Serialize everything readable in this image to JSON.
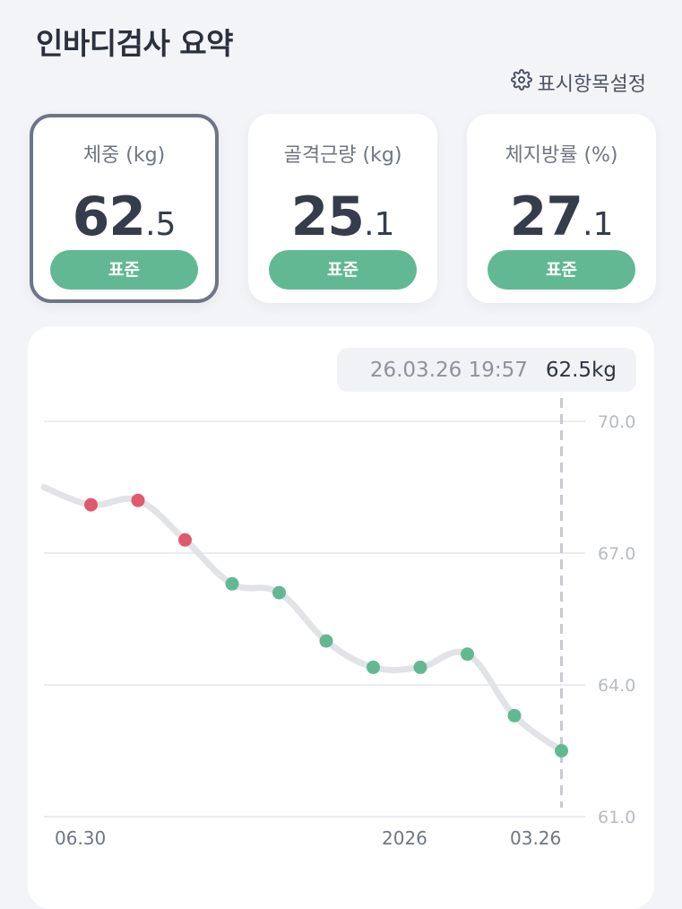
{
  "header": {
    "title": "인바디검사 요약",
    "settings_label": "표시항목설정"
  },
  "cards": [
    {
      "label": "체중 (kg)",
      "value_int": "62",
      "value_dec": ".5",
      "status": "표준",
      "selected": true
    },
    {
      "label": "골격근량 (kg)",
      "value_int": "25",
      "value_dec": ".1",
      "status": "표준",
      "selected": false
    },
    {
      "label": "체지방률 (%)",
      "value_int": "27",
      "value_dec": ".1",
      "status": "표준",
      "selected": false
    }
  ],
  "tooltip": {
    "date": "26.03.26 19:57",
    "value": "62.5kg"
  },
  "colors": {
    "normal": "#62b893",
    "over": "#e05a6e",
    "line": "#e2e3e6",
    "accent": "#62b893"
  },
  "chart_data": {
    "type": "line",
    "series": [
      {
        "y": [
          68.5,
          68.1,
          68.2,
          67.3,
          66.3,
          66.1,
          65.0,
          64.4,
          64.4,
          64.7,
          63.3,
          62.5
        ],
        "status": [
          "",
          "over",
          "over",
          "over",
          "normal",
          "normal",
          "normal",
          "normal",
          "normal",
          "normal",
          "normal",
          "normal"
        ]
      }
    ],
    "x_tick_labels": [
      "06.30",
      "2026",
      "03.26"
    ],
    "y_ticks": [
      "70.0",
      "67.0",
      "64.0",
      "61.0"
    ],
    "ylim": [
      61.0,
      70.0
    ],
    "selected_index": 11,
    "grid": true
  }
}
